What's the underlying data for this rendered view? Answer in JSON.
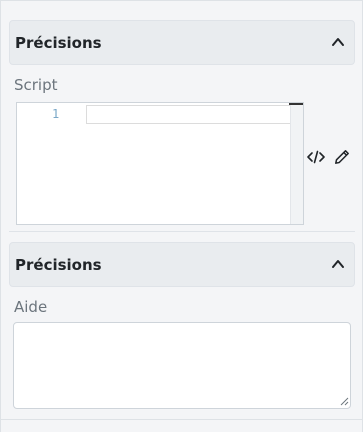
{
  "sections": [
    {
      "title": "Précisions",
      "expanded": true,
      "field_label": "Script"
    },
    {
      "title": "Précisions",
      "expanded": true,
      "field_label": "Aide"
    }
  ],
  "editor": {
    "line_numbers": [
      "1"
    ],
    "content": ""
  },
  "tools": {
    "code_icon": "code-icon",
    "edit_icon": "pencil-icon"
  },
  "help": {
    "value": ""
  },
  "colors": {
    "header_bg": "#e9ecef",
    "panel_bg": "#f4f5f7",
    "label": "#6c757d",
    "line_number": "#7aa7c7"
  }
}
